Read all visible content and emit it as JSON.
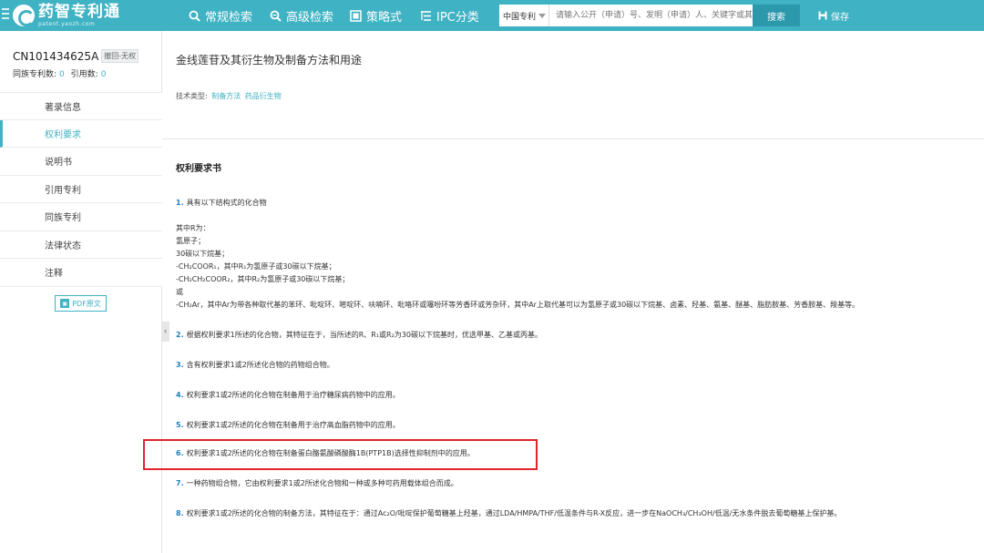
{
  "header": {
    "logo_title": "药智专利通",
    "logo_sub": "patent.yaozh.com",
    "nav": [
      {
        "label": "常规检索",
        "icon": "search-icon"
      },
      {
        "label": "高级检索",
        "icon": "advanced-search-icon"
      },
      {
        "label": "策略式",
        "icon": "strategy-icon"
      },
      {
        "label": "IPC分类",
        "icon": "ipc-icon"
      }
    ],
    "search": {
      "scope": "中国专利",
      "placeholder": "请输入公开（申请）号、发明（申请）人、关键字或其他",
      "button": "搜索"
    },
    "save_label": "保存"
  },
  "sidebar": {
    "patent_no": "CN101434625A",
    "status": "撤回-无权",
    "family_label": "同族专利数:",
    "family_count": "0",
    "cited_label": "引用数:",
    "cited_count": "0",
    "items": [
      {
        "label": "著录信息",
        "active": false
      },
      {
        "label": "权利要求",
        "active": true
      },
      {
        "label": "说明书",
        "active": false
      },
      {
        "label": "引用专利",
        "active": false
      },
      {
        "label": "同族专利",
        "active": false
      },
      {
        "label": "法律状态",
        "active": false
      },
      {
        "label": "注释",
        "active": false
      }
    ],
    "pdf_label": "PDF原文"
  },
  "main": {
    "title": "金线莲苷及其衍生物及制备方法和用途",
    "tech_type_label": "技术类型:",
    "tech_tags": [
      "制备方法",
      "药品衍生物"
    ],
    "section_title": "权利要求书",
    "claim1": {
      "num": "1.",
      "text": "具有以下结构式的化合物"
    },
    "claim1_lines": [
      "其中R为：",
      "氢原子；",
      "30碳以下烷基；",
      "-CH₂COOR₁，其中R₁为氢原子或30碳以下烷基；",
      "-CH₂CH₂COOR₂，其中R₂为氢原子或30碳以下烷基；",
      "或",
      "-CH₂Ar，其中Ar为带各种取代基的苯环、吡啶环、嘧啶环、呋喃环、吡咯环或噻吩环等芳香环或芳杂环，其中Ar上取代基可以为氢原子或30碳以下烷基、卤素、羟基、氨基、醚基、脂肪胺基、芳香胺基、羧基等。"
    ],
    "claims": [
      {
        "num": "2.",
        "text": "根据权利要求1所述的化合物，其特征在于，当所述的R、R₁或R₂为30碳以下烷基时，优选甲基、乙基或丙基。"
      },
      {
        "num": "3.",
        "text": "含有权利要求1或2所述化合物的药物组合物。"
      },
      {
        "num": "4.",
        "text": "权利要求1或2所述的化合物在制备用于治疗糖尿病药物中的应用。"
      },
      {
        "num": "5.",
        "text": "权利要求1或2所述的化合物在制备用于治疗高血脂药物中的应用。"
      },
      {
        "num": "6.",
        "text": "权利要求1或2所述的化合物在制备蛋白酪氨酸磷酸酶1B(PTP1B)选择性抑制剂中的应用。"
      },
      {
        "num": "7.",
        "text": "一种药物组合物，它由权利要求1或2所述化合物和一种或多种可药用载体组合而成。"
      },
      {
        "num": "8.",
        "text": "权利要求1或2所述的化合物的制备方法，其特征在于：通过Ac₂O/吡啶保护葡萄糖基上羟基，通过LDA/HMPA/THF/低温条件与R-X反应，进一步在NaOCH₃/CH₃OH/低温/无水条件脱去葡萄糖基上保护基。"
      }
    ],
    "highlighted_claim": "6."
  },
  "colors": {
    "brand": "#3fb2c3",
    "claim_number": "#1f7fbd",
    "highlight": "#e2232a"
  }
}
